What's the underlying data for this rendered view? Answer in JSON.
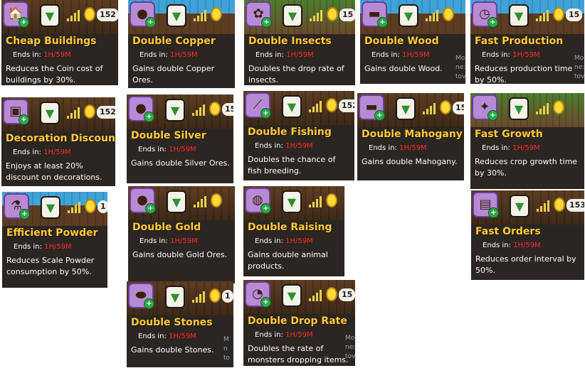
{
  "ends_label": "Ends in:",
  "ends_time": "1H/59M",
  "cards": [
    {
      "title": "Cheap Buildings",
      "desc": "Reduces the Coin cost of buildings by 30%.",
      "icon": "building-icon",
      "glyph": "🏠",
      "coins": "152",
      "side": ""
    },
    {
      "title": "Double Copper",
      "desc": "Gains double Copper Ores.",
      "icon": "copper-ore-icon",
      "glyph": "●",
      "coins": "",
      "side": ""
    },
    {
      "title": "Double Insects",
      "desc": "Doubles the drop rate of insects.",
      "icon": "insect-icon",
      "glyph": "✿",
      "coins": "15",
      "side": ""
    },
    {
      "title": "Double Wood",
      "desc": "Gains double Wood.",
      "icon": "wood-icon",
      "glyph": "▬",
      "coins": "",
      "side": "Mo ne: tov"
    },
    {
      "title": "Fast Production",
      "desc": "Reduces production time by 50%.",
      "icon": "clock-icon",
      "glyph": "◷",
      "coins": "15",
      "side": "Mo ne: tov"
    },
    {
      "title": "Decoration Discount",
      "desc": "Enjoys at least 20% discount on decorations.",
      "icon": "decoration-icon",
      "glyph": "▣",
      "coins": "152",
      "side": ""
    },
    {
      "title": "Double Silver",
      "desc": "Gains double Silver Ores.",
      "icon": "silver-ore-icon",
      "glyph": "●",
      "coins": "15",
      "side": ""
    },
    {
      "title": "Double Fishing",
      "desc": "Doubles the chance of fish breeding.",
      "icon": "fishing-icon",
      "glyph": "⟋",
      "coins": "152",
      "side": ""
    },
    {
      "title": "Double Mahogany",
      "desc": "Gains double Mahogany.",
      "icon": "mahogany-icon",
      "glyph": "▬",
      "coins": "15",
      "side": ""
    },
    {
      "title": "Fast Growth",
      "desc": "Reduces crop growth time by 30%.",
      "icon": "crop-icon",
      "glyph": "✦",
      "coins": "",
      "side": ""
    },
    {
      "title": "Efficient Powder",
      "desc": "Reduces Scale Powder consumption by 50%.",
      "icon": "powder-bottle-icon",
      "glyph": "⚗",
      "coins": "1",
      "side": ""
    },
    {
      "title": "Double Gold",
      "desc": "Gains double Gold Ores.",
      "icon": "gold-ore-icon",
      "glyph": "●",
      "coins": "",
      "side": ""
    },
    {
      "title": "Double Raising",
      "desc": "Gains double animal products.",
      "icon": "animal-product-icon",
      "glyph": "◍",
      "coins": "",
      "side": ""
    },
    {
      "title": "Fast Orders",
      "desc": "Reduces order interval by 50%.",
      "icon": "order-board-icon",
      "glyph": "▤",
      "coins": "153",
      "side": ""
    },
    {
      "title": "Double Stones",
      "desc": "Gains double Stones.",
      "icon": "stone-icon",
      "glyph": "⬬",
      "coins": "1",
      "side": "M n to"
    },
    {
      "title": "Double Drop Rate",
      "desc": "Doubles the rate of monsters dropping items.",
      "icon": "drop-bag-icon",
      "glyph": "◔",
      "coins": "15",
      "side": "Mo ne: tov"
    }
  ]
}
